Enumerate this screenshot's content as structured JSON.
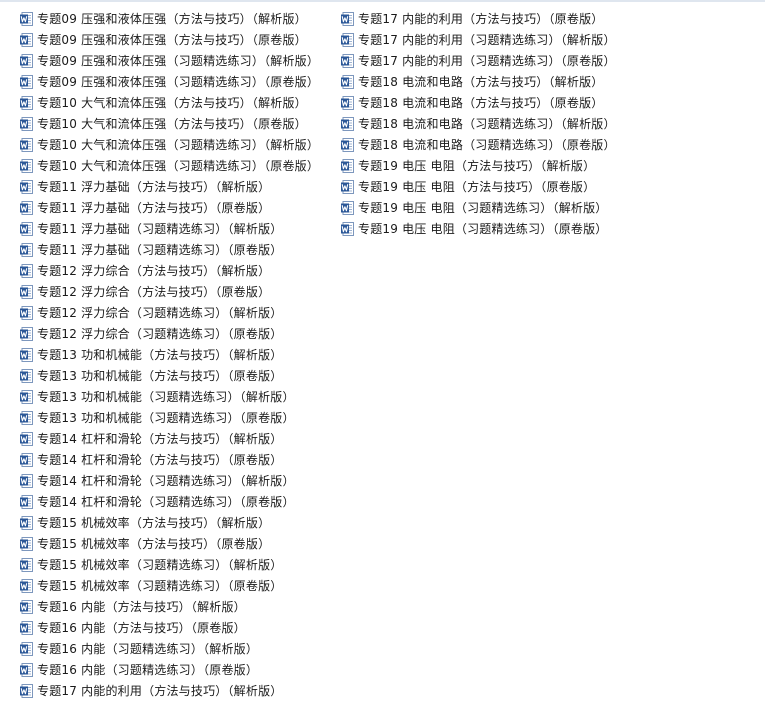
{
  "icon": "word-document-icon",
  "colors": {
    "icon_blue": "#2b5797",
    "icon_light": "#ffffff",
    "text": "#1a1a1a",
    "background": "#ffffff"
  },
  "columns": [
    {
      "items": [
        {
          "name": "专题09 压强和液体压强（方法与技巧）（解析版）"
        },
        {
          "name": "专题09 压强和液体压强（方法与技巧）（原卷版）"
        },
        {
          "name": "专题09 压强和液体压强（习题精选练习）（解析版）"
        },
        {
          "name": "专题09 压强和液体压强（习题精选练习）（原卷版）"
        },
        {
          "name": "专题10 大气和流体压强（方法与技巧）（解析版）"
        },
        {
          "name": "专题10 大气和流体压强（方法与技巧）（原卷版）"
        },
        {
          "name": "专题10 大气和流体压强（习题精选练习）（解析版）"
        },
        {
          "name": "专题10 大气和流体压强（习题精选练习）（原卷版）"
        },
        {
          "name": "专题11 浮力基础（方法与技巧）（解析版）"
        },
        {
          "name": "专题11 浮力基础（方法与技巧）（原卷版）"
        },
        {
          "name": "专题11 浮力基础（习题精选练习）（解析版）"
        },
        {
          "name": "专题11 浮力基础（习题精选练习）（原卷版）"
        },
        {
          "name": "专题12 浮力综合（方法与技巧）（解析版）"
        },
        {
          "name": "专题12 浮力综合（方法与技巧）（原卷版）"
        },
        {
          "name": "专题12 浮力综合（习题精选练习）（解析版）"
        },
        {
          "name": "专题12 浮力综合（习题精选练习）（原卷版）"
        },
        {
          "name": "专题13 功和机械能（方法与技巧）（解析版）"
        },
        {
          "name": "专题13 功和机械能（方法与技巧）（原卷版）"
        },
        {
          "name": "专题13 功和机械能（习题精选练习）（解析版）"
        },
        {
          "name": "专题13 功和机械能（习题精选练习）（原卷版）"
        },
        {
          "name": "专题14 杠杆和滑轮（方法与技巧）（解析版）"
        },
        {
          "name": "专题14 杠杆和滑轮（方法与技巧）（原卷版）"
        },
        {
          "name": "专题14 杠杆和滑轮（习题精选练习）（解析版）"
        },
        {
          "name": "专题14 杠杆和滑轮（习题精选练习）（原卷版）"
        },
        {
          "name": "专题15 机械效率（方法与技巧）（解析版）"
        },
        {
          "name": "专题15 机械效率（方法与技巧）（原卷版）"
        },
        {
          "name": "专题15 机械效率（习题精选练习）（解析版）"
        },
        {
          "name": "专题15 机械效率（习题精选练习）（原卷版）"
        },
        {
          "name": "专题16 内能（方法与技巧）（解析版）"
        },
        {
          "name": "专题16 内能（方法与技巧）（原卷版）"
        },
        {
          "name": "专题16 内能（习题精选练习）（解析版）"
        },
        {
          "name": "专题16 内能（习题精选练习）（原卷版）"
        },
        {
          "name": "专题17 内能的利用（方法与技巧）（解析版）"
        }
      ]
    },
    {
      "items": [
        {
          "name": "专题17 内能的利用（方法与技巧）（原卷版）"
        },
        {
          "name": "专题17 内能的利用（习题精选练习）（解析版）"
        },
        {
          "name": "专题17 内能的利用（习题精选练习）（原卷版）"
        },
        {
          "name": "专题18 电流和电路（方法与技巧）（解析版）"
        },
        {
          "name": "专题18 电流和电路（方法与技巧）（原卷版）"
        },
        {
          "name": "专题18 电流和电路（习题精选练习）（解析版）"
        },
        {
          "name": "专题18 电流和电路（习题精选练习）（原卷版）"
        },
        {
          "name": "专题19 电压 电阻（方法与技巧）（解析版）"
        },
        {
          "name": "专题19 电压 电阻（方法与技巧）（原卷版）"
        },
        {
          "name": "专题19 电压 电阻（习题精选练习）（解析版）"
        },
        {
          "name": "专题19 电压 电阻（习题精选练习）（原卷版）"
        }
      ]
    }
  ]
}
